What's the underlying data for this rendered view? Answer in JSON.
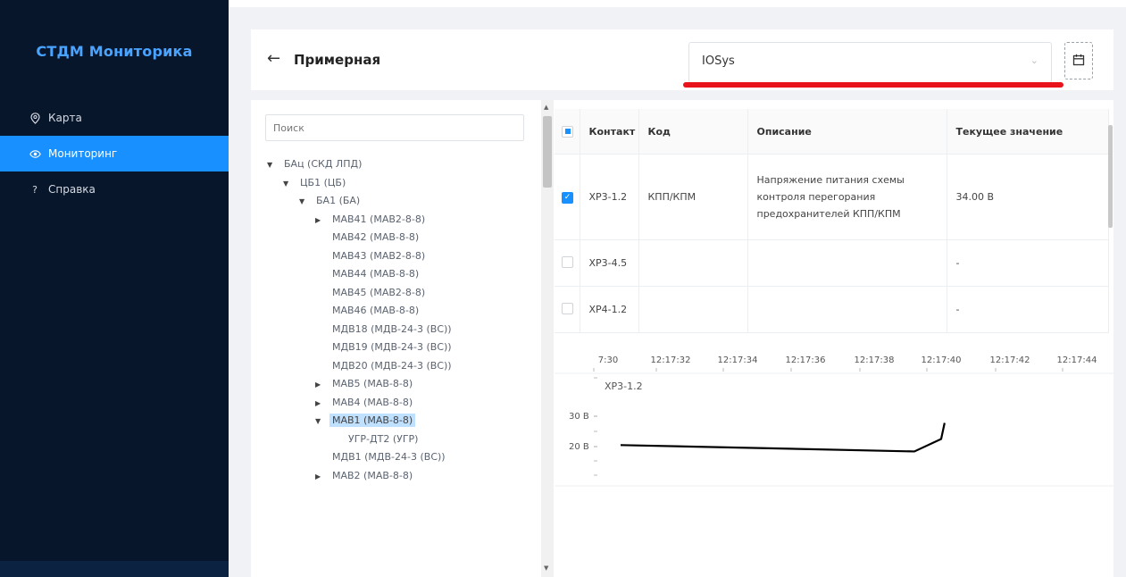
{
  "sidebar": {
    "brand": "СТДМ Мониторика",
    "items": [
      {
        "label": "Карта",
        "icon": "map-pin-icon",
        "active": false
      },
      {
        "label": "Мониторинг",
        "icon": "eye-icon",
        "active": true
      },
      {
        "label": "Справка",
        "icon": "question-icon",
        "active": false
      }
    ]
  },
  "header": {
    "title": "Примерная",
    "select_value": "IOSys"
  },
  "tree": {
    "search_placeholder": "Поиск",
    "nodes": [
      {
        "label": "БАц (СКД ЛПД)",
        "level": 0,
        "arrow": "down"
      },
      {
        "label": "ЦБ1 (ЦБ)",
        "level": 1,
        "arrow": "down"
      },
      {
        "label": "БА1 (БА)",
        "level": 2,
        "arrow": "down"
      },
      {
        "label": "МАВ41 (МАВ2-8-8)",
        "level": 3,
        "arrow": "right"
      },
      {
        "label": "МАВ42 (МАВ-8-8)",
        "level": 3,
        "arrow": ""
      },
      {
        "label": "МАВ43 (МАВ2-8-8)",
        "level": 3,
        "arrow": ""
      },
      {
        "label": "МАВ44 (МАВ-8-8)",
        "level": 3,
        "arrow": ""
      },
      {
        "label": "МАВ45 (МАВ2-8-8)",
        "level": 3,
        "arrow": ""
      },
      {
        "label": "МАВ46 (МАВ-8-8)",
        "level": 3,
        "arrow": ""
      },
      {
        "label": "МДВ18 (МДВ-24-3 (ВС))",
        "level": 3,
        "arrow": ""
      },
      {
        "label": "МДВ19 (МДВ-24-3 (ВС))",
        "level": 3,
        "arrow": ""
      },
      {
        "label": "МДВ20 (МДВ-24-3 (ВС))",
        "level": 3,
        "arrow": ""
      },
      {
        "label": "МАВ5 (МАВ-8-8)",
        "level": 3,
        "arrow": "right"
      },
      {
        "label": "МАВ4 (МАВ-8-8)",
        "level": 3,
        "arrow": "right"
      },
      {
        "label": "МАВ1 (МАВ-8-8)",
        "level": 3,
        "arrow": "down",
        "selected": true
      },
      {
        "label": "УГР-ДТ2 (УГР)",
        "level": 4,
        "arrow": ""
      },
      {
        "label": "МДВ1 (МДВ-24-3 (ВС))",
        "level": 3,
        "arrow": ""
      },
      {
        "label": "МАВ2 (МАВ-8-8)",
        "level": 3,
        "arrow": "right"
      }
    ]
  },
  "table": {
    "headers": [
      "Контакт",
      "Код",
      "Описание",
      "Текущее значение"
    ],
    "rows": [
      {
        "checked": true,
        "contact": "ХР3-1.2",
        "code": "КПП/КПМ",
        "description": "Напряжение питания схемы контроля перегорания предохранителей КПП/КПМ",
        "value": "34.00 В"
      },
      {
        "checked": false,
        "contact": "ХР3-4.5",
        "code": "",
        "description": "",
        "value": "-"
      },
      {
        "checked": false,
        "contact": "ХР4-1.2",
        "code": "",
        "description": "",
        "value": "-"
      }
    ]
  },
  "chart_data": {
    "type": "line",
    "title": "",
    "xlabel": "",
    "ylabel": "",
    "x_tick_labels": [
      "7:30",
      "12:17:32",
      "12:17:34",
      "12:17:36",
      "12:17:38",
      "12:17:40",
      "12:17:42",
      "12:17:44"
    ],
    "y_tick_labels": [
      "30 В",
      "20 В"
    ],
    "series": [
      {
        "name": "ХР3-1.2",
        "color": "#000000",
        "x": [
          "12:17:30.4",
          "12:17:39.2",
          "12:17:40.0",
          "12:17:40.1"
        ],
        "y": [
          20.5,
          18.4,
          22.5,
          27.8
        ]
      }
    ]
  }
}
